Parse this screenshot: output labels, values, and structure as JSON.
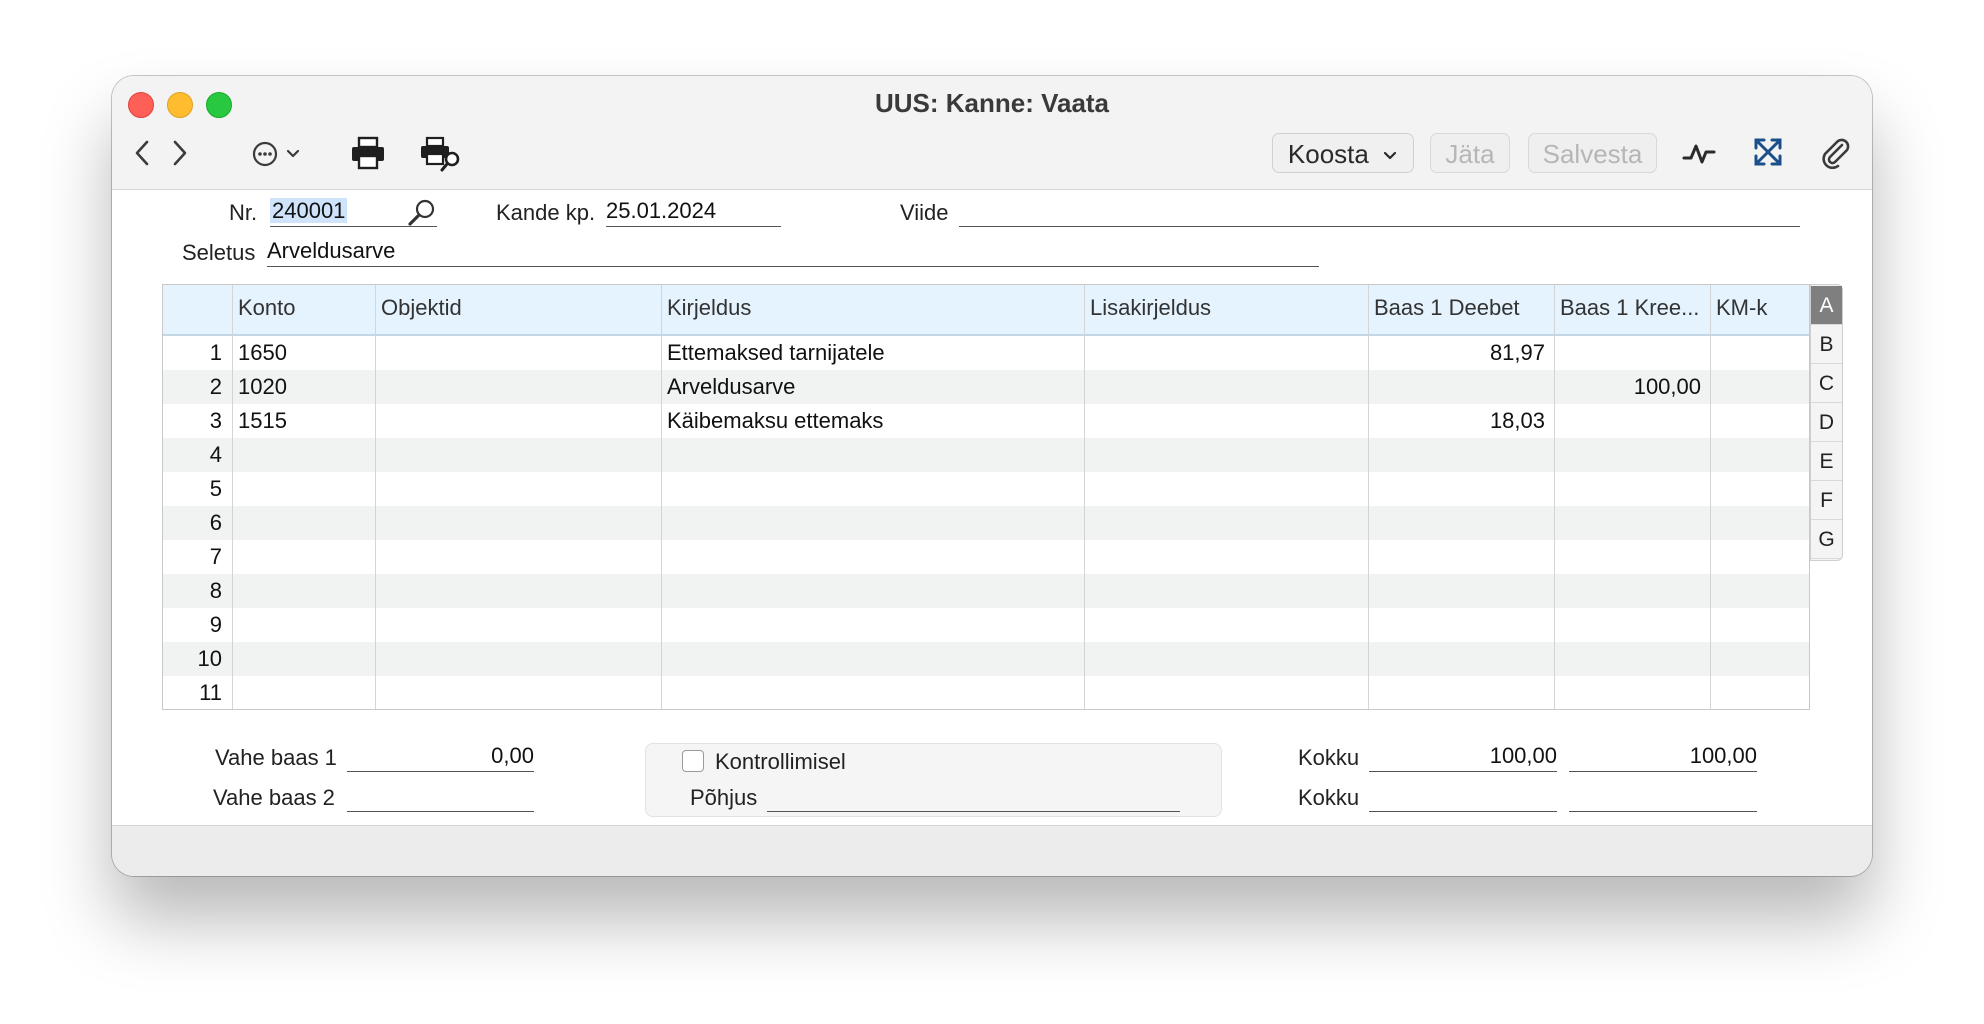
{
  "window": {
    "title": "UUS: Kanne: Vaata"
  },
  "toolbar": {
    "back_icon": "chevron-left-icon",
    "forward_icon": "chevron-right-icon",
    "more_icon": "ellipsis-circle-icon",
    "print_icon": "printer-icon",
    "print_preview_icon": "print-preview-icon",
    "koosta_label": "Koosta",
    "jata_label": "Jäta",
    "salvesta_label": "Salvesta",
    "activity_icon": "activity-icon",
    "expand_icon": "expand-arrows-icon",
    "attach_icon": "paperclip-icon"
  },
  "header": {
    "nr_label": "Nr.",
    "nr_value": "240001",
    "kande_kp_label": "Kande kp.",
    "kande_kp_value": "25.01.2024",
    "viide_label": "Viide",
    "viide_value": "",
    "seletus_label": "Seletus",
    "seletus_value": "Arveldusarve"
  },
  "grid": {
    "columns": [
      "",
      "Konto",
      "Objektid",
      "Kirjeldus",
      "Lisakirjeldus",
      "Baas 1 Deebet",
      "Baas 1 Kree...",
      "KM-k"
    ],
    "rows": [
      {
        "n": "1",
        "konto": "1650",
        "objektid": "",
        "kirjeldus": "Ettemaksed tarnijatele",
        "lisakirjeldus": "",
        "deebet": "81,97",
        "kreedit": "",
        "kmk": ""
      },
      {
        "n": "2",
        "konto": "1020",
        "objektid": "",
        "kirjeldus": "Arveldusarve",
        "lisakirjeldus": "",
        "deebet": "",
        "kreedit": "100,00",
        "kmk": ""
      },
      {
        "n": "3",
        "konto": "1515",
        "objektid": "",
        "kirjeldus": "Käibemaksu ettemaks",
        "lisakirjeldus": "",
        "deebet": "18,03",
        "kreedit": "",
        "kmk": ""
      },
      {
        "n": "4",
        "konto": "",
        "objektid": "",
        "kirjeldus": "",
        "lisakirjeldus": "",
        "deebet": "",
        "kreedit": "",
        "kmk": ""
      },
      {
        "n": "5",
        "konto": "",
        "objektid": "",
        "kirjeldus": "",
        "lisakirjeldus": "",
        "deebet": "",
        "kreedit": "",
        "kmk": ""
      },
      {
        "n": "6",
        "konto": "",
        "objektid": "",
        "kirjeldus": "",
        "lisakirjeldus": "",
        "deebet": "",
        "kreedit": "",
        "kmk": ""
      },
      {
        "n": "7",
        "konto": "",
        "objektid": "",
        "kirjeldus": "",
        "lisakirjeldus": "",
        "deebet": "",
        "kreedit": "",
        "kmk": ""
      },
      {
        "n": "8",
        "konto": "",
        "objektid": "",
        "kirjeldus": "",
        "lisakirjeldus": "",
        "deebet": "",
        "kreedit": "",
        "kmk": ""
      },
      {
        "n": "9",
        "konto": "",
        "objektid": "",
        "kirjeldus": "",
        "lisakirjeldus": "",
        "deebet": "",
        "kreedit": "",
        "kmk": ""
      },
      {
        "n": "10",
        "konto": "",
        "objektid": "",
        "kirjeldus": "",
        "lisakirjeldus": "",
        "deebet": "",
        "kreedit": "",
        "kmk": ""
      },
      {
        "n": "11",
        "konto": "",
        "objektid": "",
        "kirjeldus": "",
        "lisakirjeldus": "",
        "deebet": "",
        "kreedit": "",
        "kmk": ""
      }
    ],
    "tabs": [
      "A",
      "B",
      "C",
      "D",
      "E",
      "F",
      "G"
    ],
    "active_tab": "A"
  },
  "footer": {
    "vahe_baas1_label": "Vahe baas 1",
    "vahe_baas1_value": "0,00",
    "vahe_baas2_label": "Vahe baas 2",
    "vahe_baas2_value": "",
    "kontrollimisel_label": "Kontrollimisel",
    "kontrollimisel_checked": false,
    "pohjus_label": "Põhjus",
    "pohjus_value": "",
    "kokku1_label": "Kokku",
    "kokku1_deebet": "100,00",
    "kokku1_kreedit": "100,00",
    "kokku2_label": "Kokku",
    "kokku2_deebet": "",
    "kokku2_kreedit": ""
  },
  "colors": {
    "header_bg": "#e4f3fd",
    "selection": "#cfe3fb",
    "active_tab": "#7f7f7f",
    "close": "#fe5f57",
    "minimize": "#febc2e",
    "zoom": "#28c840"
  }
}
